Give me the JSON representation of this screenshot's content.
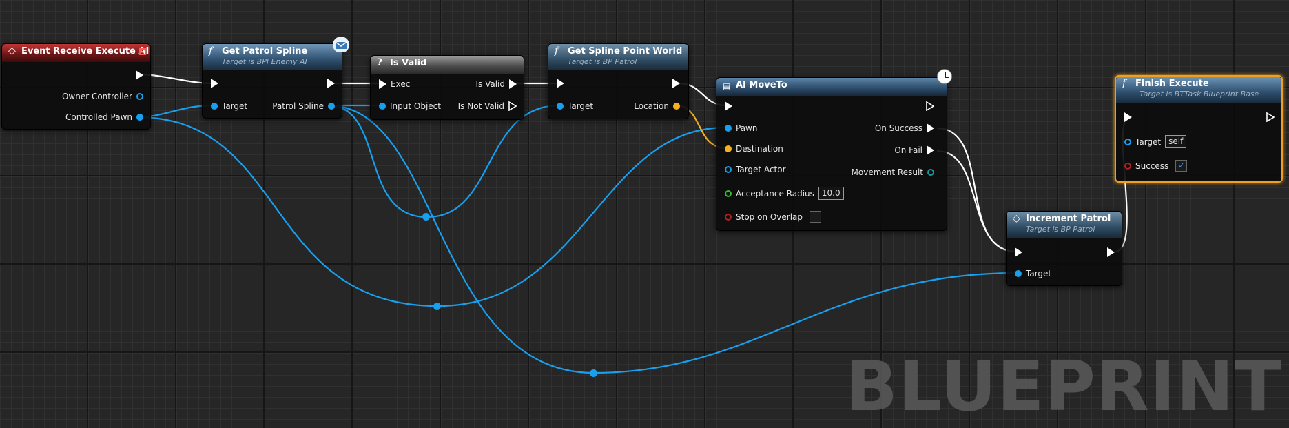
{
  "watermark": "BLUEPRINT",
  "nodes": {
    "event_receive": {
      "title": "Event Receive Execute AI",
      "pins": {
        "owner_controller": "Owner Controller",
        "controlled_pawn": "Controlled Pawn"
      }
    },
    "get_patrol_spline": {
      "title": "Get Patrol Spline",
      "subtitle": "Target is BPI Enemy AI",
      "pins": {
        "target": "Target",
        "patrol_spline": "Patrol Spline"
      }
    },
    "is_valid": {
      "title": "Is Valid",
      "pins": {
        "exec": "Exec",
        "is_valid": "Is Valid",
        "input_object": "Input Object",
        "is_not_valid": "Is Not Valid"
      }
    },
    "get_spline_point": {
      "title": "Get Spline Point World",
      "subtitle": "Target is BP Patrol",
      "pins": {
        "target": "Target",
        "location": "Location"
      }
    },
    "ai_moveto": {
      "title": "AI MoveTo",
      "pins": {
        "pawn": "Pawn",
        "destination": "Destination",
        "target_actor": "Target Actor",
        "acceptance_radius": "Acceptance Radius",
        "acceptance_radius_value": "10.0",
        "stop_on_overlap": "Stop on Overlap",
        "on_success": "On Success",
        "on_fail": "On Fail",
        "movement_result": "Movement Result"
      }
    },
    "finish_execute": {
      "title": "Finish Execute",
      "subtitle": "Target is BTTask Blueprint Base",
      "pins": {
        "target": "Target",
        "target_value": "self",
        "success": "Success",
        "success_checked": true
      }
    },
    "increment_patrol": {
      "title": "Increment Patrol",
      "subtitle": "Target is BP Patrol",
      "pins": {
        "target": "Target"
      }
    }
  },
  "colors": {
    "exec_wire": "#ffffff",
    "object_wire": "#18a0f0",
    "vector_wire": "#f4b020",
    "selection": "#f0a020"
  }
}
